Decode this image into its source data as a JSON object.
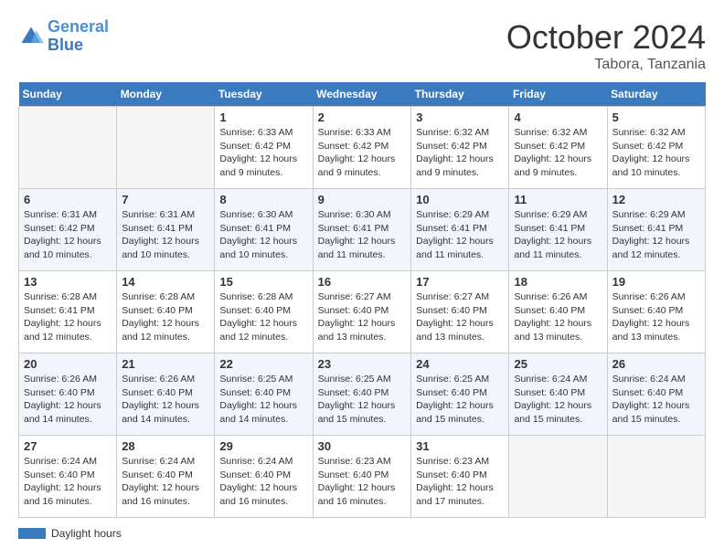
{
  "header": {
    "logo_line1": "General",
    "logo_line2": "Blue",
    "month": "October 2024",
    "location": "Tabora, Tanzania"
  },
  "legend": {
    "label": "Daylight hours"
  },
  "days_of_week": [
    "Sunday",
    "Monday",
    "Tuesday",
    "Wednesday",
    "Thursday",
    "Friday",
    "Saturday"
  ],
  "weeks": [
    [
      {
        "day": "",
        "sunrise": "",
        "sunset": "",
        "daylight": ""
      },
      {
        "day": "",
        "sunrise": "",
        "sunset": "",
        "daylight": ""
      },
      {
        "day": "1",
        "sunrise": "Sunrise: 6:33 AM",
        "sunset": "Sunset: 6:42 PM",
        "daylight": "Daylight: 12 hours and 9 minutes."
      },
      {
        "day": "2",
        "sunrise": "Sunrise: 6:33 AM",
        "sunset": "Sunset: 6:42 PM",
        "daylight": "Daylight: 12 hours and 9 minutes."
      },
      {
        "day": "3",
        "sunrise": "Sunrise: 6:32 AM",
        "sunset": "Sunset: 6:42 PM",
        "daylight": "Daylight: 12 hours and 9 minutes."
      },
      {
        "day": "4",
        "sunrise": "Sunrise: 6:32 AM",
        "sunset": "Sunset: 6:42 PM",
        "daylight": "Daylight: 12 hours and 9 minutes."
      },
      {
        "day": "5",
        "sunrise": "Sunrise: 6:32 AM",
        "sunset": "Sunset: 6:42 PM",
        "daylight": "Daylight: 12 hours and 10 minutes."
      }
    ],
    [
      {
        "day": "6",
        "sunrise": "Sunrise: 6:31 AM",
        "sunset": "Sunset: 6:42 PM",
        "daylight": "Daylight: 12 hours and 10 minutes."
      },
      {
        "day": "7",
        "sunrise": "Sunrise: 6:31 AM",
        "sunset": "Sunset: 6:41 PM",
        "daylight": "Daylight: 12 hours and 10 minutes."
      },
      {
        "day": "8",
        "sunrise": "Sunrise: 6:30 AM",
        "sunset": "Sunset: 6:41 PM",
        "daylight": "Daylight: 12 hours and 10 minutes."
      },
      {
        "day": "9",
        "sunrise": "Sunrise: 6:30 AM",
        "sunset": "Sunset: 6:41 PM",
        "daylight": "Daylight: 12 hours and 11 minutes."
      },
      {
        "day": "10",
        "sunrise": "Sunrise: 6:29 AM",
        "sunset": "Sunset: 6:41 PM",
        "daylight": "Daylight: 12 hours and 11 minutes."
      },
      {
        "day": "11",
        "sunrise": "Sunrise: 6:29 AM",
        "sunset": "Sunset: 6:41 PM",
        "daylight": "Daylight: 12 hours and 11 minutes."
      },
      {
        "day": "12",
        "sunrise": "Sunrise: 6:29 AM",
        "sunset": "Sunset: 6:41 PM",
        "daylight": "Daylight: 12 hours and 12 minutes."
      }
    ],
    [
      {
        "day": "13",
        "sunrise": "Sunrise: 6:28 AM",
        "sunset": "Sunset: 6:41 PM",
        "daylight": "Daylight: 12 hours and 12 minutes."
      },
      {
        "day": "14",
        "sunrise": "Sunrise: 6:28 AM",
        "sunset": "Sunset: 6:40 PM",
        "daylight": "Daylight: 12 hours and 12 minutes."
      },
      {
        "day": "15",
        "sunrise": "Sunrise: 6:28 AM",
        "sunset": "Sunset: 6:40 PM",
        "daylight": "Daylight: 12 hours and 12 minutes."
      },
      {
        "day": "16",
        "sunrise": "Sunrise: 6:27 AM",
        "sunset": "Sunset: 6:40 PM",
        "daylight": "Daylight: 12 hours and 13 minutes."
      },
      {
        "day": "17",
        "sunrise": "Sunrise: 6:27 AM",
        "sunset": "Sunset: 6:40 PM",
        "daylight": "Daylight: 12 hours and 13 minutes."
      },
      {
        "day": "18",
        "sunrise": "Sunrise: 6:26 AM",
        "sunset": "Sunset: 6:40 PM",
        "daylight": "Daylight: 12 hours and 13 minutes."
      },
      {
        "day": "19",
        "sunrise": "Sunrise: 6:26 AM",
        "sunset": "Sunset: 6:40 PM",
        "daylight": "Daylight: 12 hours and 13 minutes."
      }
    ],
    [
      {
        "day": "20",
        "sunrise": "Sunrise: 6:26 AM",
        "sunset": "Sunset: 6:40 PM",
        "daylight": "Daylight: 12 hours and 14 minutes."
      },
      {
        "day": "21",
        "sunrise": "Sunrise: 6:26 AM",
        "sunset": "Sunset: 6:40 PM",
        "daylight": "Daylight: 12 hours and 14 minutes."
      },
      {
        "day": "22",
        "sunrise": "Sunrise: 6:25 AM",
        "sunset": "Sunset: 6:40 PM",
        "daylight": "Daylight: 12 hours and 14 minutes."
      },
      {
        "day": "23",
        "sunrise": "Sunrise: 6:25 AM",
        "sunset": "Sunset: 6:40 PM",
        "daylight": "Daylight: 12 hours and 15 minutes."
      },
      {
        "day": "24",
        "sunrise": "Sunrise: 6:25 AM",
        "sunset": "Sunset: 6:40 PM",
        "daylight": "Daylight: 12 hours and 15 minutes."
      },
      {
        "day": "25",
        "sunrise": "Sunrise: 6:24 AM",
        "sunset": "Sunset: 6:40 PM",
        "daylight": "Daylight: 12 hours and 15 minutes."
      },
      {
        "day": "26",
        "sunrise": "Sunrise: 6:24 AM",
        "sunset": "Sunset: 6:40 PM",
        "daylight": "Daylight: 12 hours and 15 minutes."
      }
    ],
    [
      {
        "day": "27",
        "sunrise": "Sunrise: 6:24 AM",
        "sunset": "Sunset: 6:40 PM",
        "daylight": "Daylight: 12 hours and 16 minutes."
      },
      {
        "day": "28",
        "sunrise": "Sunrise: 6:24 AM",
        "sunset": "Sunset: 6:40 PM",
        "daylight": "Daylight: 12 hours and 16 minutes."
      },
      {
        "day": "29",
        "sunrise": "Sunrise: 6:24 AM",
        "sunset": "Sunset: 6:40 PM",
        "daylight": "Daylight: 12 hours and 16 minutes."
      },
      {
        "day": "30",
        "sunrise": "Sunrise: 6:23 AM",
        "sunset": "Sunset: 6:40 PM",
        "daylight": "Daylight: 12 hours and 16 minutes."
      },
      {
        "day": "31",
        "sunrise": "Sunrise: 6:23 AM",
        "sunset": "Sunset: 6:40 PM",
        "daylight": "Daylight: 12 hours and 17 minutes."
      },
      {
        "day": "",
        "sunrise": "",
        "sunset": "",
        "daylight": ""
      },
      {
        "day": "",
        "sunrise": "",
        "sunset": "",
        "daylight": ""
      }
    ]
  ]
}
